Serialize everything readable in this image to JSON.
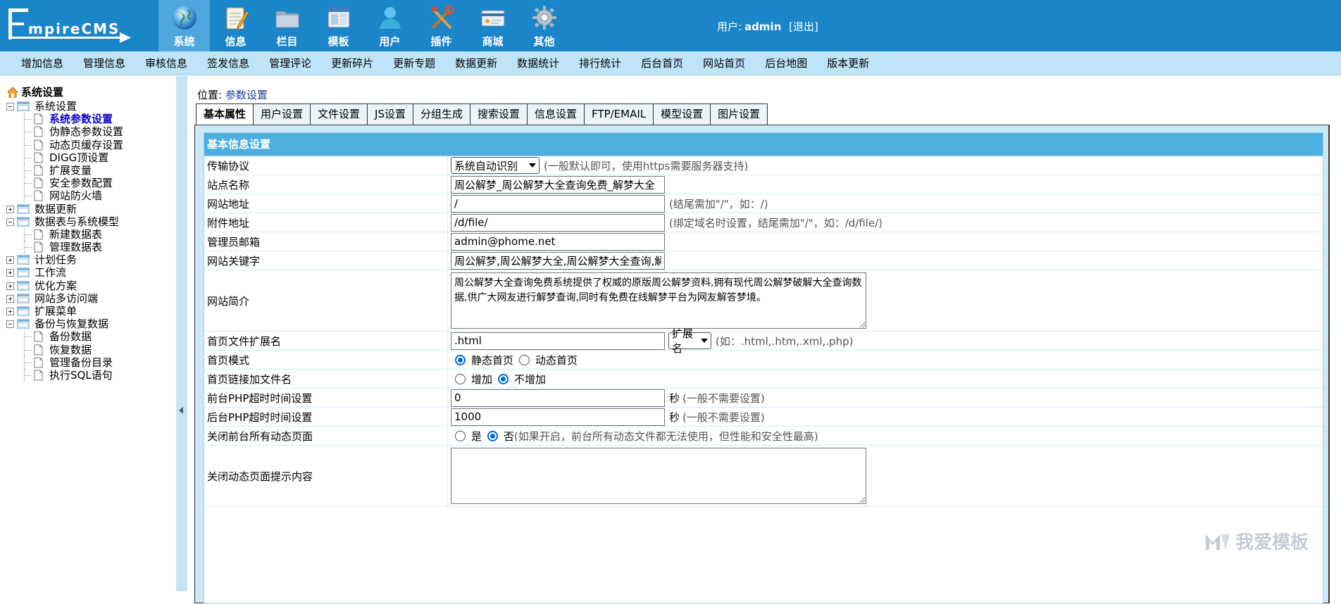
{
  "header": {
    "logo_text": "EmpireCMS",
    "nav": [
      {
        "label": "系统",
        "icon": "globe-icon",
        "active": true
      },
      {
        "label": "信息",
        "icon": "notepad-icon"
      },
      {
        "label": "栏目",
        "icon": "folder-icon"
      },
      {
        "label": "模板",
        "icon": "window-icon"
      },
      {
        "label": "用户",
        "icon": "user-icon"
      },
      {
        "label": "插件",
        "icon": "tools-icon"
      },
      {
        "label": "商城",
        "icon": "card-icon"
      },
      {
        "label": "其他",
        "icon": "gear-icon"
      }
    ],
    "user_prefix": "用户:",
    "username": "admin",
    "logout": "[退出]"
  },
  "submenu": [
    "增加信息",
    "管理信息",
    "审核信息",
    "签发信息",
    "管理评论",
    "更新碎片",
    "更新专题",
    "数据更新",
    "数据统计",
    "排行统计",
    "后台首页",
    "网站首页",
    "后台地图",
    "版本更新"
  ],
  "sidebar": {
    "root": "系统设置",
    "groups": [
      {
        "label": "系统设置",
        "open": true,
        "children": [
          "系统参数设置",
          "伪静态参数设置",
          "动态页缓存设置",
          "DIGG顶设置",
          "扩展变量",
          "安全参数配置",
          "网站防火墙"
        ]
      },
      {
        "label": "数据更新",
        "open": false
      },
      {
        "label": "数据表与系统模型",
        "open": true,
        "children": [
          "新建数据表",
          "管理数据表"
        ]
      },
      {
        "label": "计划任务",
        "open": false
      },
      {
        "label": "工作流",
        "open": false
      },
      {
        "label": "优化方案",
        "open": false
      },
      {
        "label": "网站多访问端",
        "open": false
      },
      {
        "label": "扩展菜单",
        "open": false
      },
      {
        "label": "备份与恢复数据",
        "open": true,
        "children": [
          "备份数据",
          "恢复数据",
          "管理备份目录",
          "执行SQL语句"
        ]
      }
    ]
  },
  "main": {
    "location_label": "位置:",
    "location_link": "参数设置",
    "tabs": [
      "基本属性",
      "用户设置",
      "文件设置",
      "JS设置",
      "分组生成",
      "搜索设置",
      "信息设置",
      "FTP/EMAIL",
      "模型设置",
      "图片设置"
    ],
    "form_title": "基本信息设置",
    "fields": {
      "protocol": {
        "label": "传输协议",
        "value": "系统自动识别",
        "hint": "(一般默认即可，使用https需要服务器支持)"
      },
      "site_name": {
        "label": "站点名称",
        "value": "周公解梦_周公解梦大全查询免费_解梦大全"
      },
      "site_url": {
        "label": "网站地址",
        "value": "/",
        "hint": "(结尾需加\"/\"，如：/)"
      },
      "attach_url": {
        "label": "附件地址",
        "value": "/d/file/",
        "hint": "(绑定域名时设置，结尾需加\"/\"，如：/d/file/)"
      },
      "admin_email": {
        "label": "管理员邮箱",
        "value": "admin@phome.net"
      },
      "keywords": {
        "label": "网站关键字",
        "value": "周公解梦,周公解梦大全,周公解梦大全查询,解"
      },
      "intro": {
        "label": "网站简介",
        "value": "周公解梦大全查询免费系统提供了权威的原版周公解梦资料,拥有现代周公解梦破解大全查询数据,供广大网友进行解梦查询,同时有免费在线解梦平台为网友解答梦境。"
      },
      "index_ext": {
        "label": "首页文件扩展名",
        "value": ".html",
        "select": "扩展名",
        "hint": "(如：.html,.htm,.xml,.php)"
      },
      "index_mode": {
        "label": "首页模式",
        "opt1": "静态首页",
        "opt2": "动态首页"
      },
      "index_link": {
        "label": "首页链接加文件名",
        "opt1": "增加",
        "opt2": "不增加"
      },
      "front_timeout": {
        "label": "前台PHP超时时间设置",
        "value": "0",
        "unit": "秒",
        "hint": "(一般不需要设置)"
      },
      "back_timeout": {
        "label": "后台PHP超时时间设置",
        "value": "1000",
        "unit": "秒",
        "hint": "(一般不需要设置)"
      },
      "close_dynamic": {
        "label": "关闭前台所有动态页面",
        "opt1": "是",
        "opt2": "否",
        "hint": "(如果开启，前台所有动态文件都无法使用，但性能和安全性最高)"
      },
      "close_msg": {
        "label": "关闭动态页面提示内容",
        "value": ""
      }
    }
  },
  "watermark": "我爱模板",
  "colors": {
    "header": "#1A86C9",
    "nav_active": "#4FA7DE",
    "submenu": "#BFE4F8",
    "form_head": "#4DAEE0"
  }
}
